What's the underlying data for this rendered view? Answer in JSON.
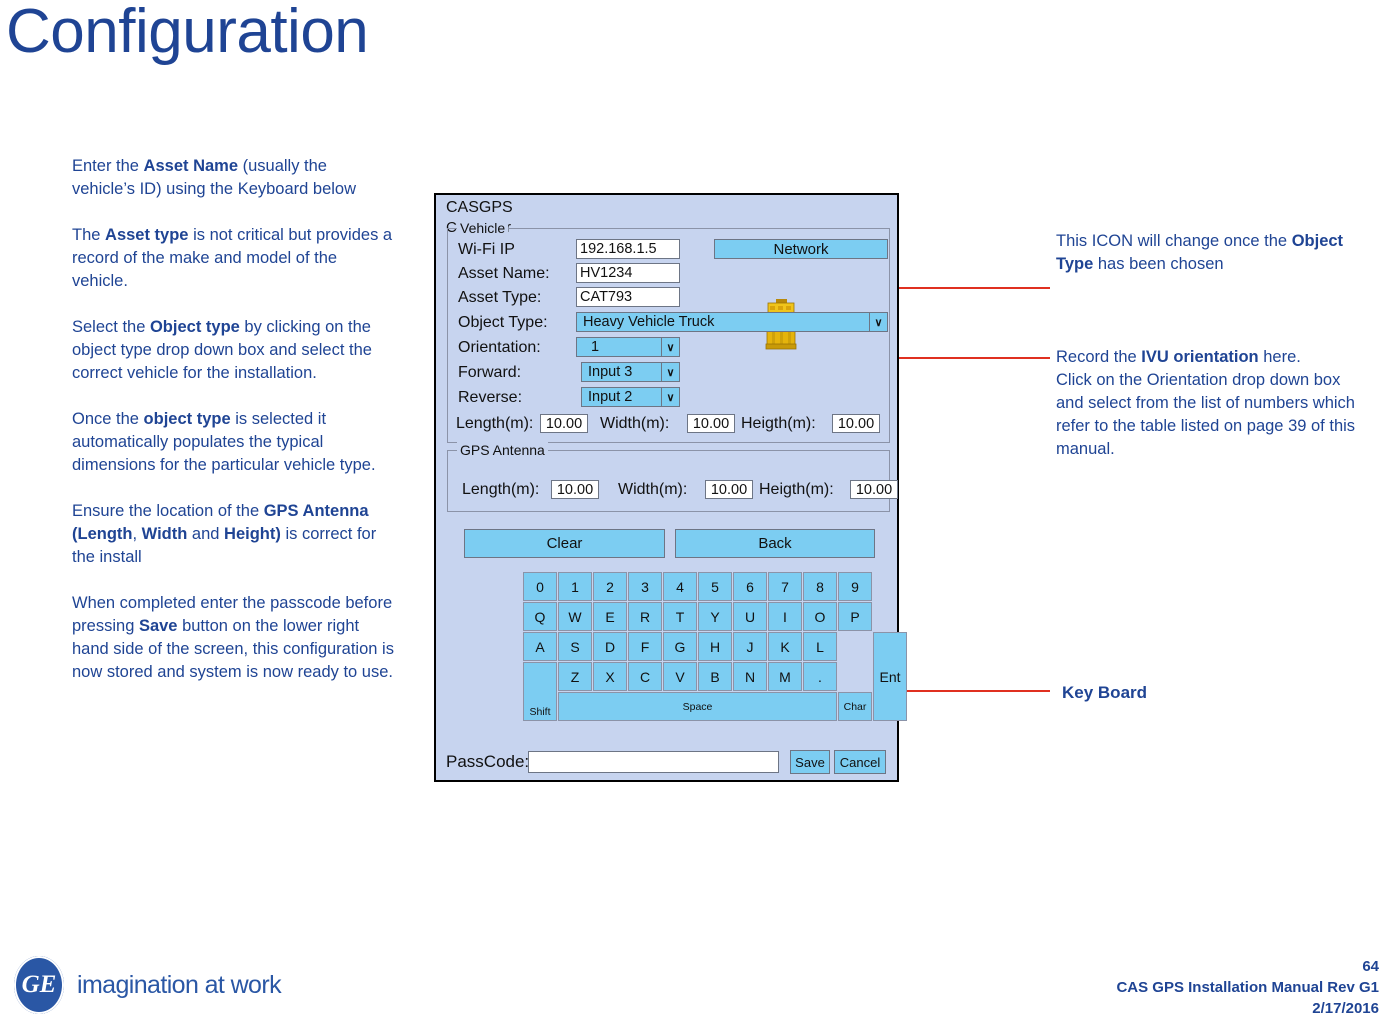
{
  "page": {
    "title": "Configuration"
  },
  "left_instructions": [
    {
      "id": "p1",
      "runs": [
        {
          "t": "Enter the ",
          "b": false
        },
        {
          "t": "Asset Name",
          "b": true
        },
        {
          "t": " (usually the vehicle’s ID) using the Keyboard below",
          "b": false
        }
      ]
    },
    {
      "id": "p2",
      "runs": [
        {
          "t": "The ",
          "b": false
        },
        {
          "t": "Asset type",
          "b": true
        },
        {
          "t": " is not critical but provides a record of the make and model of the vehicle.",
          "b": false
        }
      ]
    },
    {
      "id": "p3",
      "runs": [
        {
          "t": "Select the ",
          "b": false
        },
        {
          "t": "Object type",
          "b": true
        },
        {
          "t": " by clicking on the object type drop down box and select the correct vehicle for the installation.",
          "b": false
        }
      ]
    },
    {
      "id": "p4",
      "runs": [
        {
          "t": "Once the ",
          "b": false
        },
        {
          "t": "object type",
          "b": true
        },
        {
          "t": " is selected it automatically populates the typical dimensions for the particular vehicle type.",
          "b": false
        }
      ]
    },
    {
      "id": "p5",
      "runs": [
        {
          "t": "Ensure the location of the ",
          "b": false
        },
        {
          "t": "GPS Antenna (Length",
          "b": true
        },
        {
          "t": ", ",
          "b": false
        },
        {
          "t": "Width",
          "b": true
        },
        {
          "t": " and ",
          "b": false
        },
        {
          "t": "Height)",
          "b": true
        },
        {
          "t": " is correct for the install",
          "b": false
        }
      ]
    },
    {
      "id": "p6",
      "runs": [
        {
          "t": "When completed enter the passcode before pressing ",
          "b": false
        },
        {
          "t": "Save",
          "b": true
        },
        {
          "t": " button on the lower right hand side of the screen, this configuration is now stored and system is now ready to use.",
          "b": false
        }
      ]
    }
  ],
  "right_notes": {
    "icon_note": [
      {
        "t": "This ICON  will change once the ",
        "b": false
      },
      {
        "t": "Object Type",
        "b": true
      },
      {
        "t": " has been chosen",
        "b": false
      }
    ],
    "orientation_note": [
      {
        "t": "Record the ",
        "b": false
      },
      {
        "t": "IVU orientation",
        "b": true
      },
      {
        "t": " here.",
        "b": false
      },
      {
        "t": "\nClick on the Orientation drop down box and select from the list of numbers which refer to the table listed on page 39 of this manual.",
        "b": false
      }
    ],
    "keyboard_label": "Key Board"
  },
  "dialog": {
    "app_name": "CASGPS",
    "controller_name": "Controller",
    "vehicle_group_legend": "Vehicle",
    "antenna_group_legend": "GPS Antenna",
    "fields": {
      "wifi_ip_label": "Wi-Fi IP",
      "wifi_ip_value": "192.168.1.5",
      "asset_name_label": "Asset Name:",
      "asset_name_value": "HV1234",
      "asset_type_label": "Asset Type:",
      "asset_type_value": "CAT793",
      "object_type_label": "Object Type:",
      "object_type_value": "Heavy Vehicle Truck",
      "orientation_label": "Orientation:",
      "orientation_value": "1",
      "forward_label": "Forward:",
      "forward_value": "Input 3",
      "reverse_label": "Reverse:",
      "reverse_value": "Input 2",
      "network_button": "Network"
    },
    "vehicle_dims": {
      "length_label": "Length(m):",
      "length_value": "10.00",
      "width_label": "Width(m):",
      "width_value": "10.00",
      "height_label": "Heigth(m):",
      "height_value": "10.00"
    },
    "antenna_dims": {
      "length_label": "Length(m):",
      "length_value": "10.00",
      "width_label": "Width(m):",
      "width_value": "10.00",
      "height_label": "Heigth(m):",
      "height_value": "10.00"
    },
    "actions": {
      "clear": "Clear",
      "back": "Back",
      "save": "Save",
      "cancel": "Cancel"
    },
    "passcode": {
      "label": "PassCode:",
      "value": ""
    },
    "keyboard": {
      "row_digits": [
        "0",
        "1",
        "2",
        "3",
        "4",
        "5",
        "6",
        "7",
        "8",
        "9"
      ],
      "row_top": [
        "Q",
        "W",
        "E",
        "R",
        "T",
        "Y",
        "U",
        "I",
        "O",
        "P"
      ],
      "row_home": [
        "A",
        "S",
        "D",
        "F",
        "G",
        "H",
        "J",
        "K",
        "L"
      ],
      "row_bottom": [
        "Z",
        "X",
        "C",
        "V",
        "B",
        "N",
        "M",
        "."
      ],
      "shift": "Shift",
      "space": "Space",
      "char": "Char",
      "enter": "Ent"
    },
    "combo_arrow_glyph": "∨",
    "icon_name": "haul-truck-icon"
  },
  "footer": {
    "tagline": "imagination at work",
    "ge_mark": "GE",
    "page_number": "64",
    "manual": "CAS GPS Installation Manual Rev G1",
    "date": "2/17/2016"
  },
  "colors": {
    "brand_blue": "#1F4494",
    "accent_cyan": "#7CCDF2",
    "dialog_bg": "#C7D4EF",
    "arrow_red": "#E03020",
    "truck_gold": "#E8B408"
  }
}
